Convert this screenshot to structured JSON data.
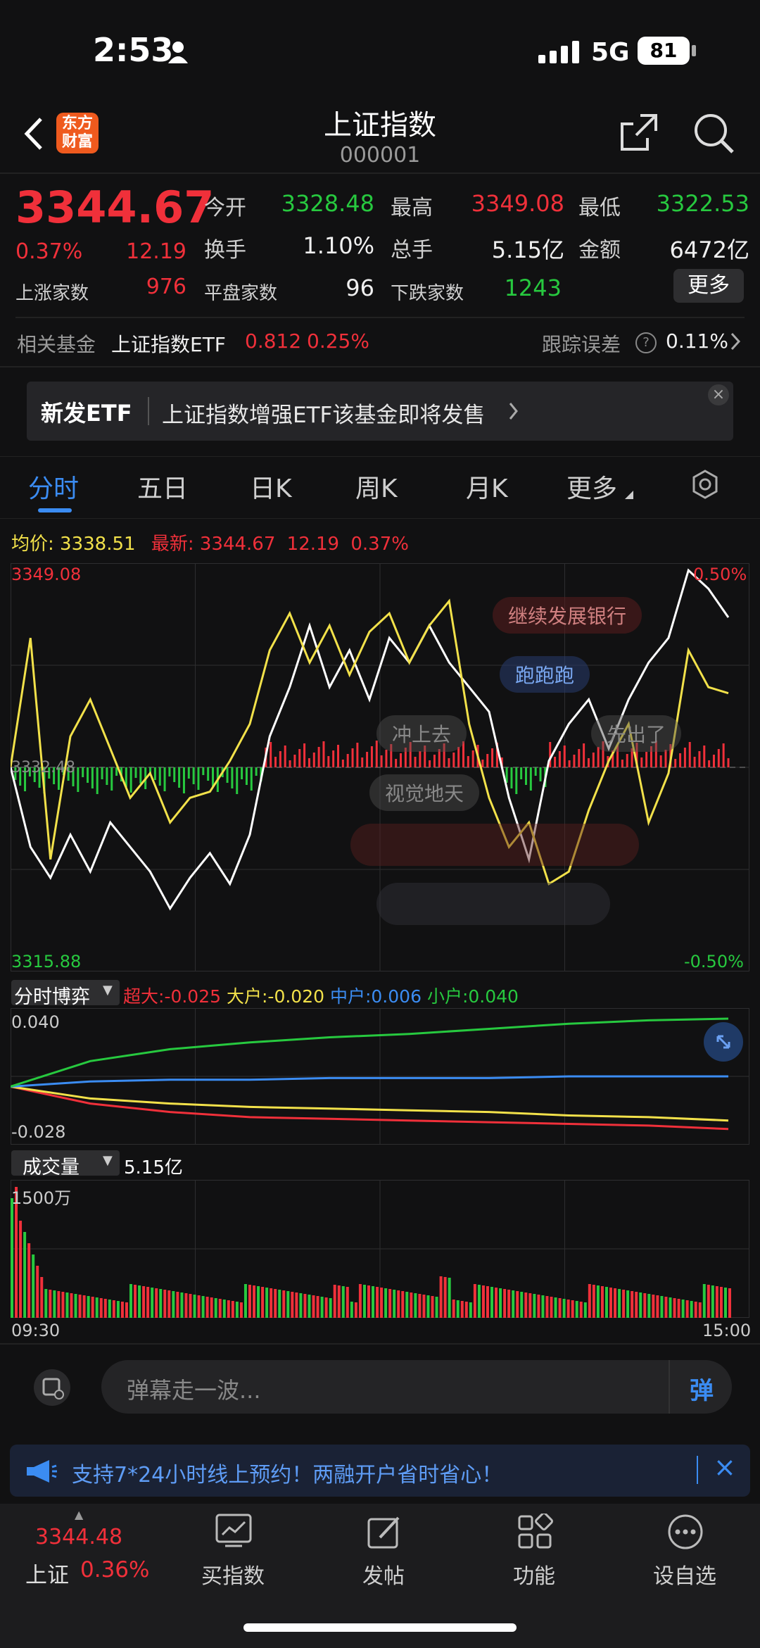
{
  "status": {
    "time": "2:53",
    "network": "5G",
    "battery": "81"
  },
  "header": {
    "title": "上证指数",
    "code": "000001",
    "logo_line1": "东方",
    "logo_line2": "财富"
  },
  "quote": {
    "price": "3344.67",
    "change_pct": "0.37%",
    "change": "12.19",
    "open_label": "今开",
    "open": "3328.48",
    "high_label": "最高",
    "high": "3349.08",
    "low_label": "最低",
    "low": "3322.53",
    "turnover_label": "换手",
    "turnover": "1.10%",
    "volume_label": "总手",
    "volume": "5.15亿",
    "amount_label": "金额",
    "amount": "6472亿",
    "up_label": "上涨家数",
    "up": "976",
    "flat_label": "平盘家数",
    "flat": "96",
    "down_label": "下跌家数",
    "down": "1243",
    "more_button": "更多"
  },
  "fund": {
    "label": "相关基金",
    "name": "上证指数ETF",
    "price": "0.812",
    "pct": "0.25%",
    "error_label": "跟踪误差",
    "error": "0.11%"
  },
  "banner": {
    "tag": "新发ETF",
    "text": "上证指数增强ETF该基金即将发售"
  },
  "tabs": [
    "分时",
    "五日",
    "日K",
    "周K",
    "月K",
    "更多"
  ],
  "legend": {
    "avg_label": "均价:",
    "avg": "3338.51",
    "latest_label": "最新:",
    "latest": "3344.67",
    "change": "12.19",
    "pct": "0.37%"
  },
  "main_chart": {
    "top": "3349.08",
    "bottom": "3315.88",
    "top_pct": "0.50%",
    "bottom_pct": "-0.50%",
    "mid": "3332.48"
  },
  "danmaku": [
    "继续发展银行",
    "跑跑跑",
    "冲上去",
    "先出了",
    "视觉地天"
  ],
  "game_panel": {
    "title": "分时博弈",
    "super_label": "超大:",
    "super": "-0.025",
    "big_label": "大户:",
    "big": "-0.020",
    "mid_label": "中户:",
    "mid": "0.006",
    "small_label": "小户:",
    "small": "0.040",
    "top": "0.040",
    "bottom": "-0.028"
  },
  "volume_panel": {
    "title": "成交量",
    "total": "5.15亿",
    "scale": "1500万",
    "time_start": "09:30",
    "time_end": "15:00"
  },
  "comment": {
    "placeholder": "弹幕走一波...",
    "send_label": "弹"
  },
  "notice": {
    "text": "支持7*24小时线上预约！两融开户省时省心！"
  },
  "bottom_nav": {
    "index_price": "3344.48",
    "index_name": "上证",
    "index_pct": "0.36%",
    "items": [
      "买指数",
      "发帖",
      "功能",
      "设自选"
    ]
  },
  "colors": {
    "up": "#f0303a",
    "down": "#27c93f",
    "avg_line": "#f2e14a",
    "price_line": "#ffffff",
    "accent": "#3b8cf2"
  },
  "chart_data": [
    {
      "type": "line",
      "title": "分时",
      "ylim": [
        3315.88,
        3349.08
      ],
      "series": [
        {
          "name": "最新",
          "values": [
            3332.5,
            3326.0,
            3323.5,
            3327.0,
            3324.0,
            3328.0,
            3326.0,
            3324.0,
            3321.0,
            3323.5,
            3325.5,
            3323.0,
            3327.0,
            3335.0,
            3339.0,
            3344.0,
            3339.0,
            3342.0,
            3338.0,
            3343.0,
            3341.0,
            3344.0,
            3341.0,
            3339.0,
            3337.0,
            3330.0,
            3325.0,
            3333.0,
            3336.0,
            3338.0,
            3334.0,
            3338.0,
            3341.0,
            3343.0,
            3348.5,
            3347.0,
            3344.67
          ]
        },
        {
          "name": "均价",
          "values": [
            3332.5,
            3343.0,
            3325.0,
            3335.0,
            3338.0,
            3334.0,
            3330.0,
            3332.0,
            3328.0,
            3330.0,
            3330.5,
            3333.0,
            3336.0,
            3342.0,
            3345.0,
            3341.0,
            3344.0,
            3340.0,
            3343.5,
            3345.0,
            3341.0,
            3344.0,
            3346.0,
            3336.0,
            3330.0,
            3326.0,
            3328.0,
            3323.0,
            3324.0,
            3329.0,
            3333.0,
            3336.0,
            3328.0,
            3332.0,
            3342.0,
            3339.0,
            3338.51
          ]
        }
      ]
    },
    {
      "type": "line",
      "title": "分时博弈",
      "ylim": [
        -0.028,
        0.04
      ],
      "series": [
        {
          "name": "超大",
          "values": [
            0.0,
            -0.01,
            -0.015,
            -0.018,
            -0.019,
            -0.02,
            -0.021,
            -0.022,
            -0.023,
            -0.025
          ]
        },
        {
          "name": "大户",
          "values": [
            0.0,
            -0.007,
            -0.01,
            -0.012,
            -0.013,
            -0.014,
            -0.015,
            -0.017,
            -0.018,
            -0.02
          ]
        },
        {
          "name": "中户",
          "values": [
            0.0,
            0.003,
            0.004,
            0.004,
            0.005,
            0.005,
            0.005,
            0.006,
            0.006,
            0.006
          ]
        },
        {
          "name": "小户",
          "values": [
            0.0,
            0.015,
            0.022,
            0.026,
            0.029,
            0.031,
            0.034,
            0.037,
            0.039,
            0.04
          ]
        }
      ]
    }
  ]
}
